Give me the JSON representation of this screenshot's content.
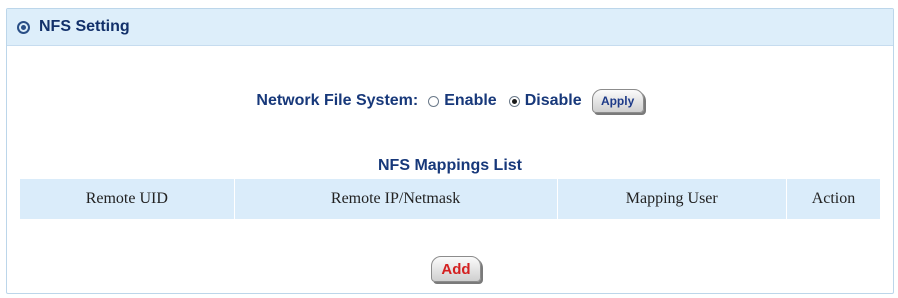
{
  "header": {
    "title": "NFS Setting",
    "icon": "settings-circle-icon"
  },
  "nfs": {
    "label": "Network File System:",
    "options": [
      {
        "label": "Enable",
        "checked": false
      },
      {
        "label": "Disable",
        "checked": true
      }
    ],
    "apply_label": "Apply"
  },
  "mappings": {
    "title": "NFS Mappings List",
    "columns": [
      "Remote UID",
      "Remote IP/Netmask",
      "Mapping User",
      "Action"
    ],
    "rows": []
  },
  "add_label": "Add",
  "colors": {
    "header_bg": "#ddeefa",
    "title_text": "#17387a",
    "add_text": "#d42020"
  }
}
